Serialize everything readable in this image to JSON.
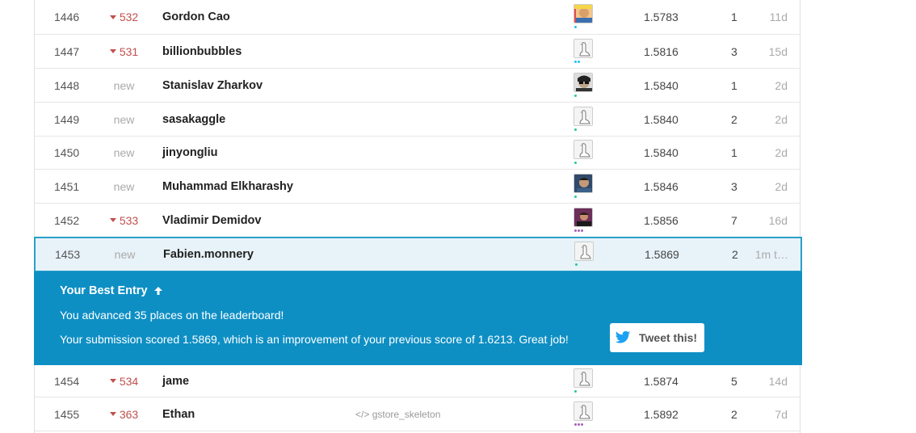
{
  "colors": {
    "accent": "#0e8fc4",
    "down": "#c0504d",
    "new": "#aaaaaa"
  },
  "rows": [
    {
      "rank": "1446",
      "delta": "532",
      "dir": "down",
      "team": "Gordon Cao",
      "kernel": "",
      "avatar": "photo-icon",
      "score": "1.5783",
      "entries": "1",
      "last": "11d"
    },
    {
      "rank": "1447",
      "delta": "531",
      "dir": "down",
      "team": "billionbubbles",
      "kernel": "",
      "avatar": "goose-icon",
      "score": "1.5816",
      "entries": "3",
      "last": "15d"
    },
    {
      "rank": "1448",
      "delta": "new",
      "dir": "new",
      "team": "Stanislav Zharkov",
      "kernel": "",
      "avatar": "photo-icon",
      "score": "1.5840",
      "entries": "1",
      "last": "2d"
    },
    {
      "rank": "1449",
      "delta": "new",
      "dir": "new",
      "team": "sasakaggle",
      "kernel": "",
      "avatar": "goose-icon",
      "score": "1.5840",
      "entries": "2",
      "last": "2d"
    },
    {
      "rank": "1450",
      "delta": "new",
      "dir": "new",
      "team": "jinyongliu",
      "kernel": "",
      "avatar": "goose-icon",
      "score": "1.5840",
      "entries": "1",
      "last": "2d"
    },
    {
      "rank": "1451",
      "delta": "new",
      "dir": "new",
      "team": "Muhammad Elkharashy",
      "kernel": "",
      "avatar": "photo-icon",
      "score": "1.5846",
      "entries": "3",
      "last": "2d"
    },
    {
      "rank": "1452",
      "delta": "533",
      "dir": "down",
      "team": "Vladimir Demidov",
      "kernel": "",
      "avatar": "photo-icon",
      "score": "1.5856",
      "entries": "7",
      "last": "16d"
    },
    {
      "rank": "1453",
      "delta": "new",
      "dir": "new",
      "team": "Fabien.monnery",
      "kernel": "",
      "avatar": "goose-icon",
      "score": "1.5869",
      "entries": "2",
      "last": "1m t…"
    },
    {
      "rank": "1454",
      "delta": "534",
      "dir": "down",
      "team": "jame",
      "kernel": "",
      "avatar": "goose-icon",
      "score": "1.5874",
      "entries": "5",
      "last": "14d"
    },
    {
      "rank": "1455",
      "delta": "363",
      "dir": "down",
      "team": "Ethan",
      "kernel": "gstore_skeleton",
      "avatar": "goose-icon",
      "score": "1.5892",
      "entries": "2",
      "last": "7d"
    }
  ],
  "banner": {
    "title": "Your Best Entry",
    "line1": "You advanced 35 places on the leaderboard!",
    "line2": "Your submission scored 1.5869, which is an improvement of your previous score of 1.6213. Great job!",
    "tweet_label": "Tweet this!"
  }
}
